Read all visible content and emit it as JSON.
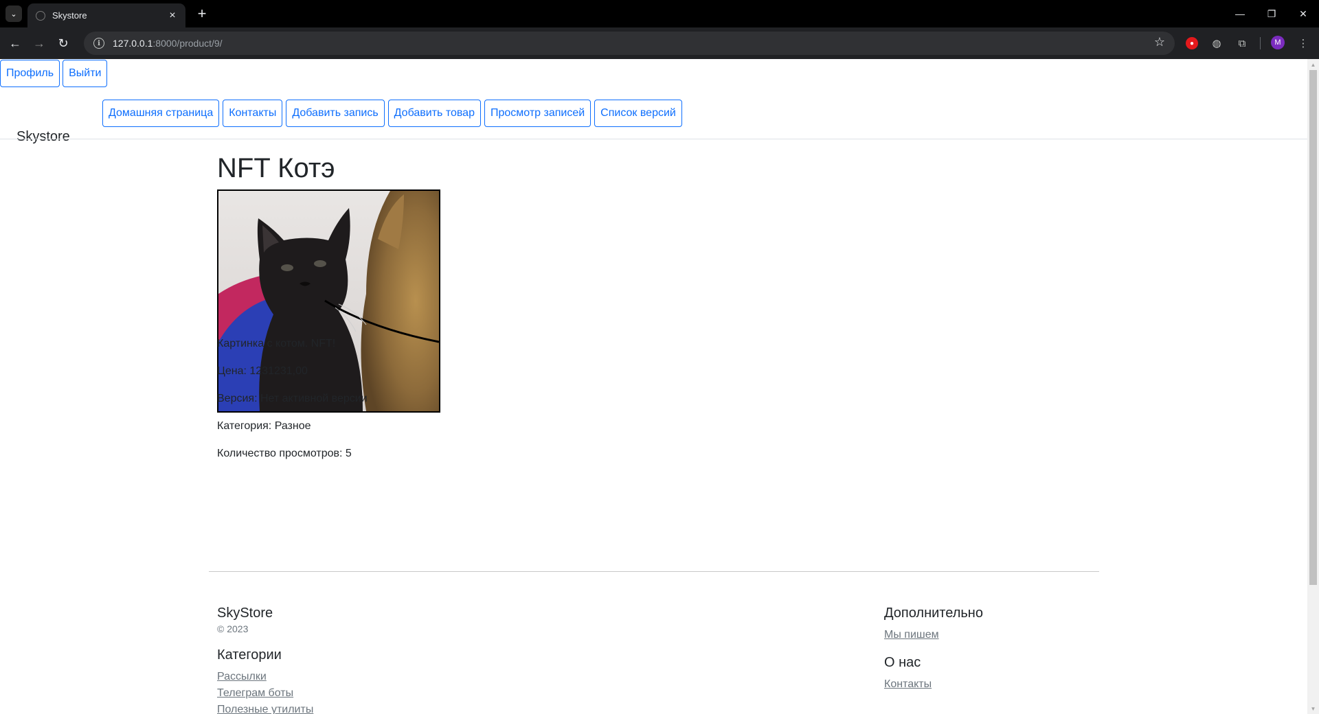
{
  "browser": {
    "tab_title": "Skystore",
    "url_host": "127.0.0.1",
    "url_rest": ":8000/product/9/",
    "avatar_letter": "M"
  },
  "top_buttons": {
    "profile": "Профиль",
    "logout": "Выйти"
  },
  "header": {
    "brand": "Skystore",
    "nav": [
      "Домашняя страница",
      "Контакты",
      "Добавить запись",
      "Добавить товар",
      "Просмотр записей",
      "Список версий"
    ]
  },
  "product": {
    "title": "NFT Котэ",
    "description": "Картинка с котом. NFT!",
    "price": "Цена: 1231231,00",
    "version": "Версия: Нет активной версии",
    "category": "Категория: Разное",
    "views": "Количество просмотров: 5"
  },
  "footer": {
    "brand": "SkyStore",
    "copyright": "© 2023",
    "categories_heading": "Категории",
    "categories": [
      "Рассылки",
      "Телеграм боты",
      "Полезные утилиты"
    ],
    "extra_heading": "Дополнительно",
    "extra_link": "Мы пишем",
    "about_heading": "О нас",
    "about_link": "Контакты"
  },
  "colors": {
    "primary": "#0d6efd",
    "muted": "#6c757d",
    "text": "#212529"
  }
}
